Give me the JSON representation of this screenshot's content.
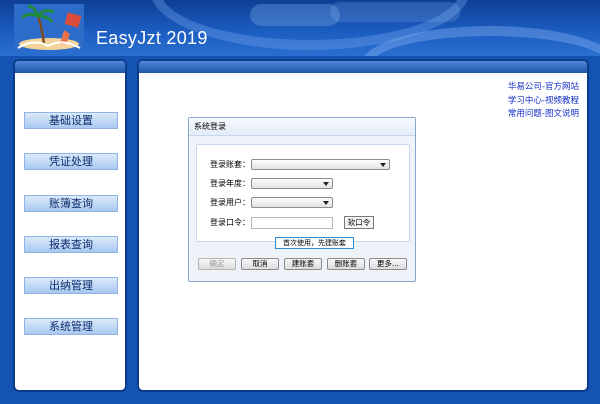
{
  "header": {
    "title": "EasyJzt 2019",
    "logo_icon": "palm-island-logo"
  },
  "sidebar": {
    "items": [
      {
        "label": "基础设置"
      },
      {
        "label": "凭证处理"
      },
      {
        "label": "账簿查询"
      },
      {
        "label": "报表查询"
      },
      {
        "label": "出纳管理"
      },
      {
        "label": "系统管理"
      }
    ]
  },
  "links": [
    {
      "label": "华易公司-官方网站"
    },
    {
      "label": "学习中心-视频教程"
    },
    {
      "label": "常用问题-图文说明"
    }
  ],
  "login_dialog": {
    "title": "系统登录",
    "account_label": "登录账套：",
    "account_value": "",
    "year_label": "登录年度：",
    "year_value": "",
    "user_label": "登录用户：",
    "user_value": "",
    "password_label": "登录口令：",
    "password_value": "",
    "keyboard_button": "软口令",
    "tip": "首次使用，先建账套",
    "buttons": {
      "confirm": "确定",
      "cancel": "取消",
      "create": "建账套",
      "delete": "删账套",
      "more": "更多..."
    }
  },
  "colors": {
    "background": "#1553b3",
    "panel_border": "#0b3c8c",
    "link": "#1530c8",
    "tip_border": "#2f8ad8"
  }
}
